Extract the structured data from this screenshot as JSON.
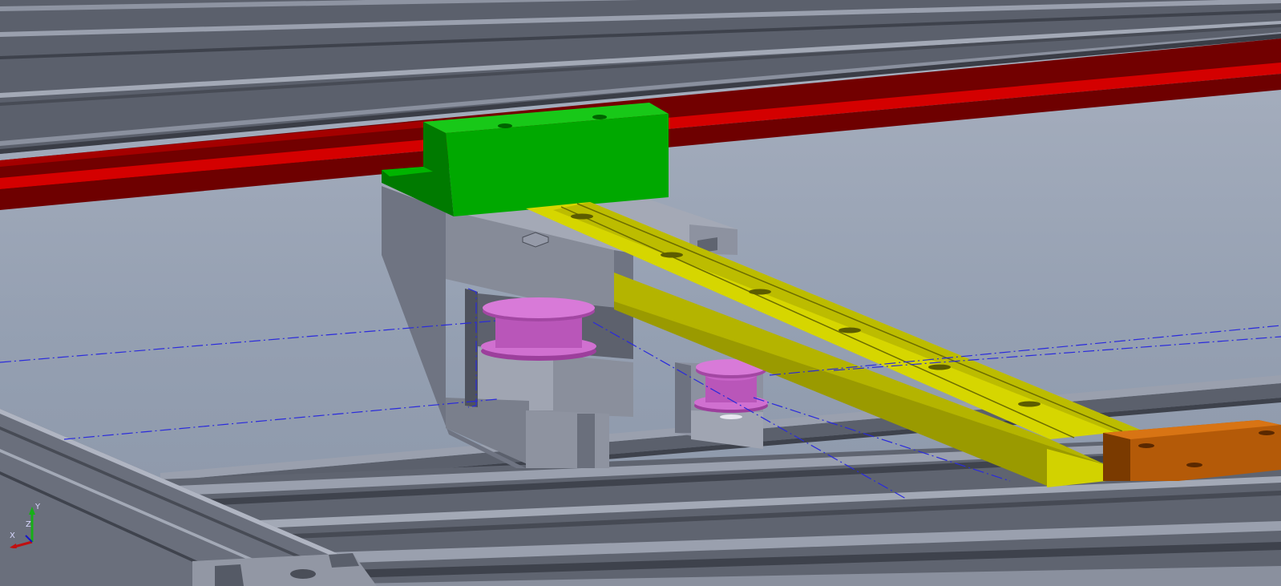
{
  "viewport": {
    "background_top": "#a9b1c0",
    "background_bottom": "#8b96a8"
  },
  "colors": {
    "extrusion_face": "#5a5f6b",
    "extrusion_light": "#9096a4",
    "extrusion_dark": "#3f434d",
    "rail_red": "#c00000",
    "rail_red_dark": "#6a0000",
    "carriage_green": "#00b000",
    "carriage_green_dark": "#007800",
    "bracket_gray": "#868b98",
    "bracket_gray_light": "#a4a9b6",
    "bracket_gray_dark": "#6f7482",
    "rail_yellow": "#c8c800",
    "rail_yellow_dark": "#8e8e00",
    "pulley_pink": "#cc66cc",
    "pulley_pink_dark": "#9c3f9c",
    "block_orange": "#b85c0a",
    "block_orange_dark": "#7a3a00",
    "centerline_blue": "#2a2adc"
  },
  "triad": {
    "axis_y": "Y",
    "axis_z": "Z",
    "axis_x": "X",
    "y_color": "#16b016",
    "x_color": "#c01010",
    "z_color": "#1616c8"
  }
}
